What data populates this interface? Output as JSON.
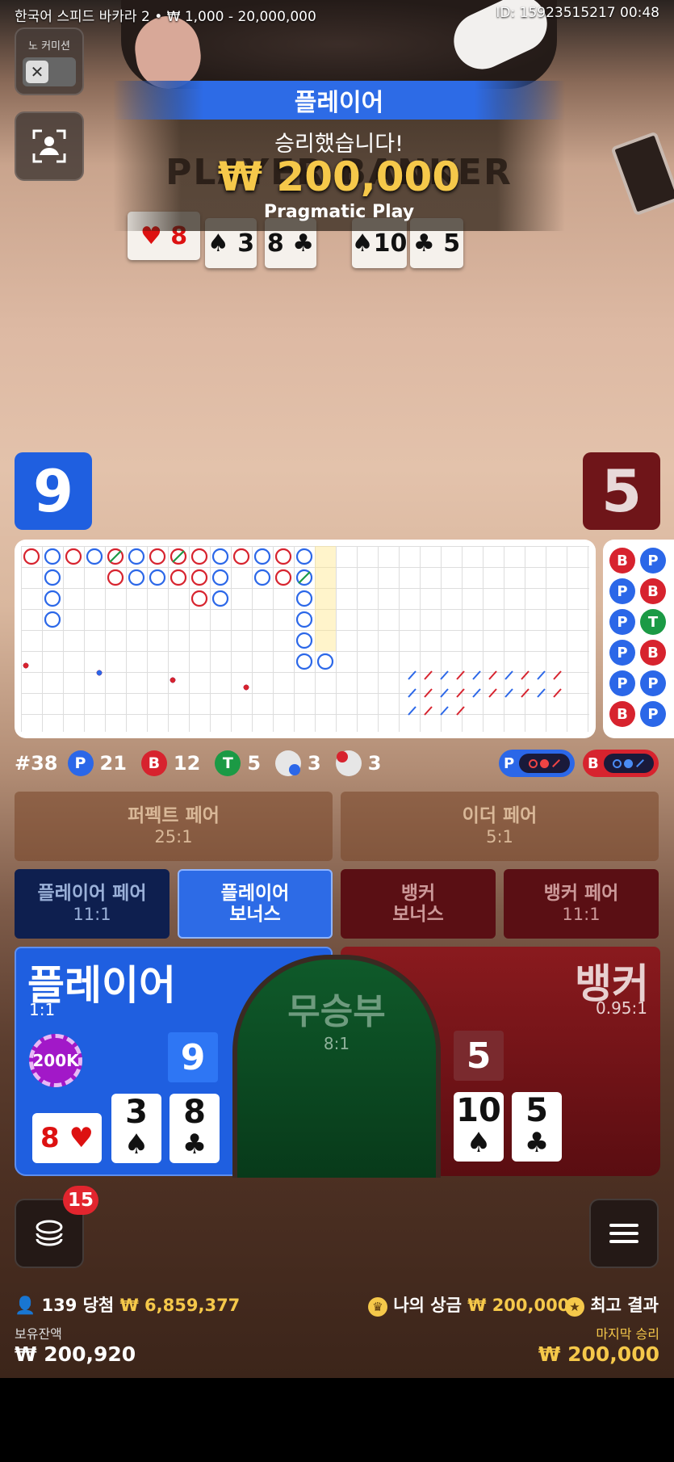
{
  "header": {
    "table": "한국어 스피드 바카라 2 • ₩ 1,000 - 20,000,000",
    "id_time": "ID: 15923515217 00:48"
  },
  "no_commission": {
    "label": "노 커미션",
    "icon": "close-icon"
  },
  "win": {
    "side": "플레이어",
    "message": "승리했습니다!",
    "amount": "₩ 200,000",
    "brand": "Pragmatic Play",
    "table_text": "PLAYER BANKER"
  },
  "scores": {
    "player": "9",
    "banker": "5"
  },
  "bead_road": [
    {
      "a": "B",
      "b": "P"
    },
    {
      "a": "P",
      "b": "B"
    },
    {
      "a": "P",
      "b": "T"
    },
    {
      "a": "P",
      "b": "B"
    },
    {
      "a": "P",
      "b": "P"
    },
    {
      "a": "B",
      "b": "P"
    }
  ],
  "stats": {
    "round": "#38",
    "p_label": "P",
    "p": "21",
    "b_label": "B",
    "b": "12",
    "t_label": "T",
    "t": "5",
    "pp": "3",
    "bp": "3"
  },
  "predict": {
    "p": "P",
    "b": "B"
  },
  "bets": {
    "perfect_pair": {
      "label": "퍼펙트 페어",
      "odds": "25:1"
    },
    "either_pair": {
      "label": "이더 페어",
      "odds": "5:1"
    },
    "player_pair": {
      "label": "플레이어 페어",
      "odds": "11:1"
    },
    "player_bonus": {
      "line1": "플레이어",
      "line2": "보너스"
    },
    "banker_bonus": {
      "line1": "뱅커",
      "line2": "보너스"
    },
    "banker_pair": {
      "label": "뱅커 페어",
      "odds": "11:1"
    },
    "player": {
      "label": "플레이어",
      "odds": "1:1",
      "chip": "200K",
      "score": "9"
    },
    "tie": {
      "label": "무승부",
      "odds": "8:1"
    },
    "banker": {
      "label": "뱅커",
      "odds": "0.95:1",
      "score": "5"
    }
  },
  "player_cards": [
    {
      "rank": "8",
      "suit": "♥"
    },
    {
      "rank": "3",
      "suit": "♠"
    },
    {
      "rank": "8",
      "suit": "♣"
    }
  ],
  "banker_cards": [
    {
      "rank": "10",
      "suit": "♠"
    },
    {
      "rank": "5",
      "suit": "♣"
    }
  ],
  "chips_badge": "15",
  "footer": {
    "winners": "139 당첨",
    "winners_amount": "₩ 6,859,377",
    "my_prize_label": "나의 상금",
    "my_prize": "₩ 200,000",
    "best_result": "최고 결과",
    "balance_label": "보유잔액",
    "balance": "₩ 200,920",
    "last_win_label": "마지막 승리",
    "last_win": "₩ 200,000"
  },
  "colors": {
    "player": "#1f5fe0",
    "banker": "#8a1a1e",
    "tie": "#0e4a22",
    "gold": "#f5c84a"
  }
}
